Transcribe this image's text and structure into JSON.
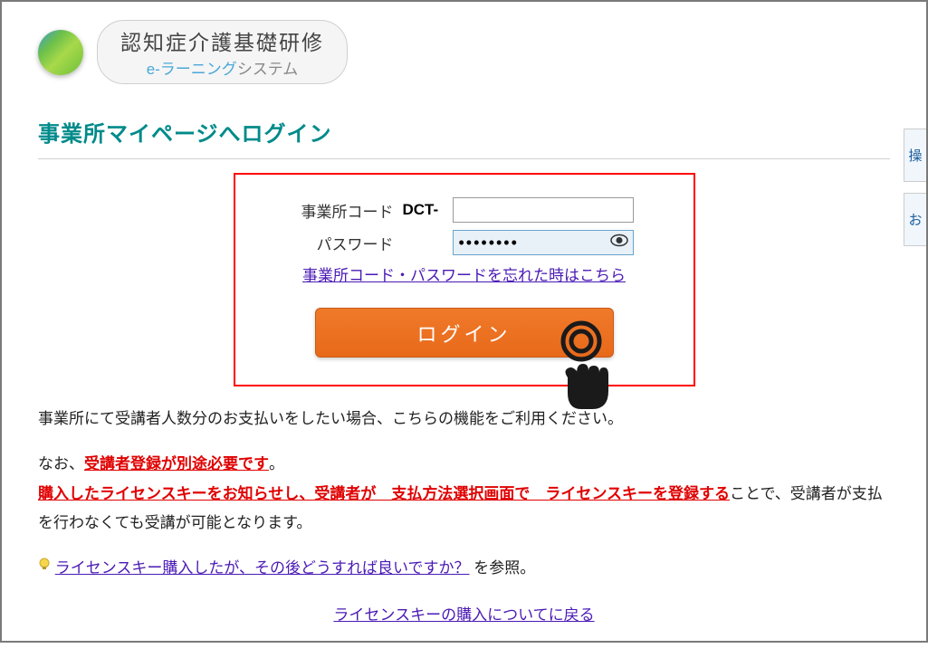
{
  "logo": {
    "title": "認知症介護基礎研修",
    "subtitle_accent": "e-ラーニング",
    "subtitle_rest": "システム"
  },
  "page_title": "事業所マイページへログイン",
  "form": {
    "code_label": "事業所コード",
    "code_prefix": "DCT-",
    "code_value": "",
    "password_label": "パスワード",
    "password_value": "••••••••",
    "forgot_link": "事業所コード・パスワードを忘れた時はこちら",
    "login_button": "ログイン"
  },
  "description": {
    "line1": "事業所にて受講者人数分のお支払いをしたい場合、こちらの機能をご利用ください。",
    "line2_a": "なお、",
    "line2_b": "受講者登録が別途必要です",
    "line2_c": "。",
    "line3_a": "購入したライセンスキーをお知らせし、受講者が　支払方法選択画面で　ライセンスキーを登録する",
    "line3_b": "ことで、受講者が支払を行わなくても受講が可能となります。",
    "faq_link": "ライセンスキー購入したが、その後どうすれば良いですか？",
    "faq_suffix": " を参照。",
    "back_link": "ライセンスキーの購入についてに戻る"
  },
  "side": {
    "tab1": "操",
    "tab2": "お"
  }
}
